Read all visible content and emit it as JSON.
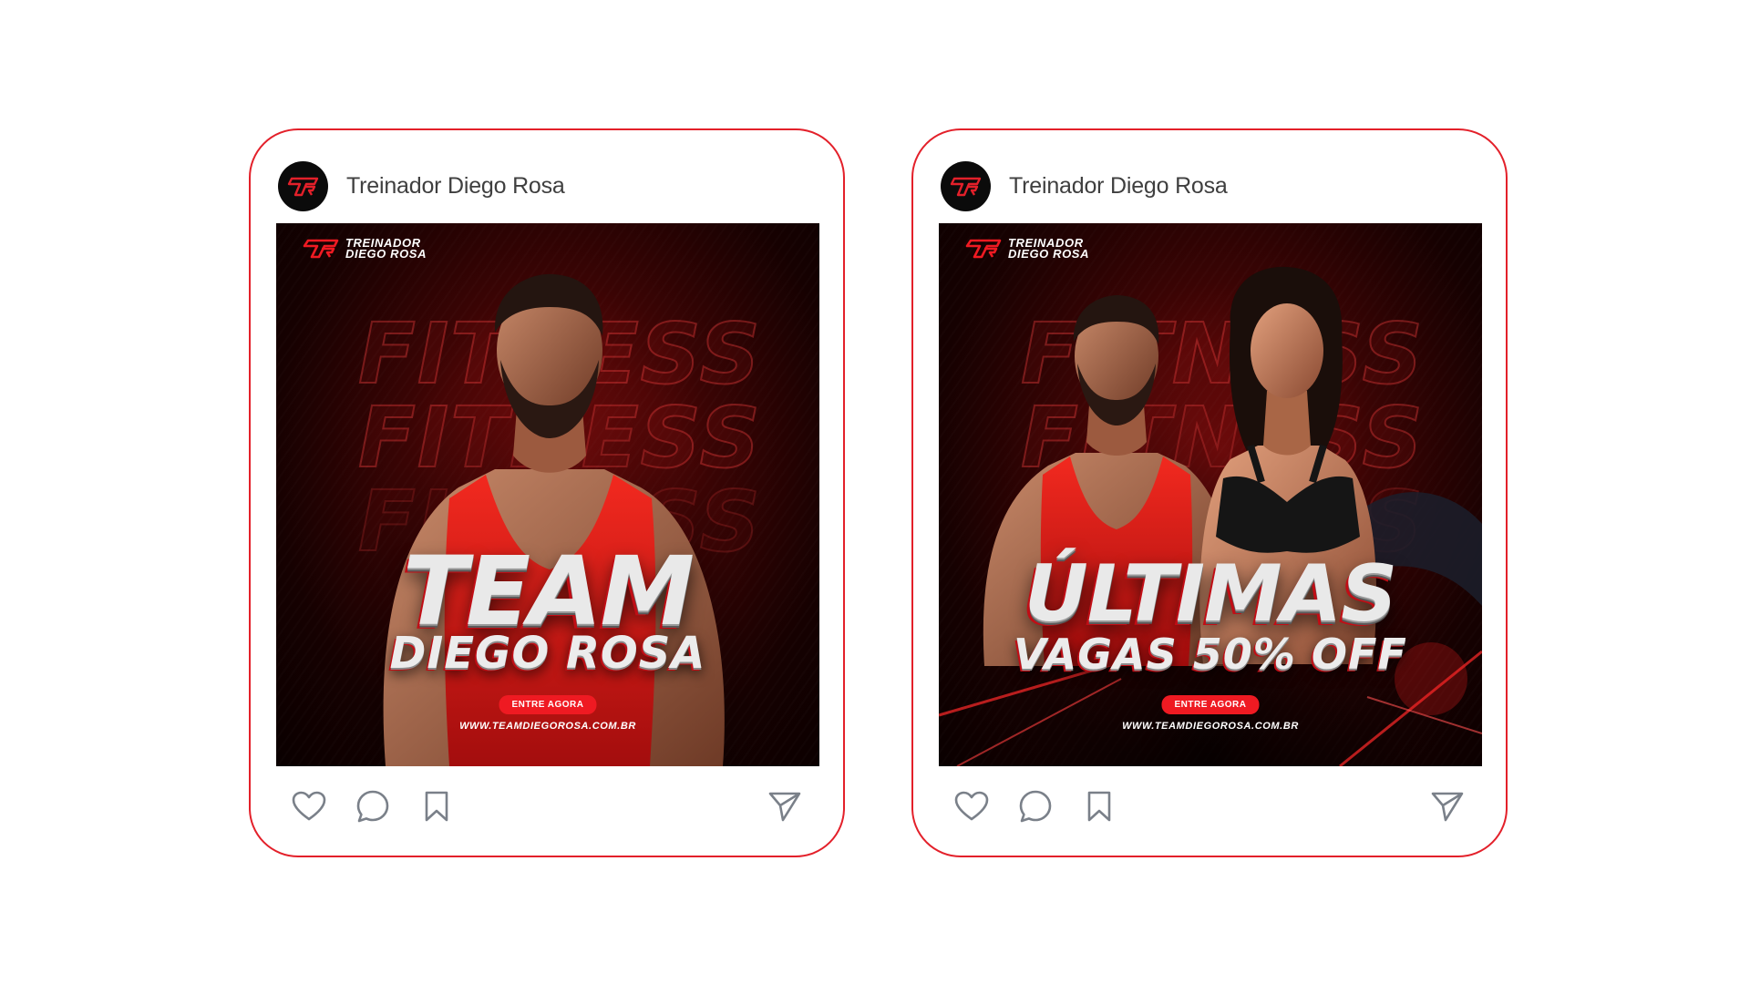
{
  "posts": [
    {
      "account_name": "Treinador Diego Rosa",
      "avatar_icon": "tr-monogram-logo",
      "creative": {
        "brand_line1": "TREINADOR",
        "brand_line2": "DIEGO ROSA",
        "background_word": "FITNESS",
        "headline_main": "TEAM",
        "headline_sub": "DIEGO ROSA",
        "cta_label": "ENTRE AGORA",
        "website": "WWW.TEAMDIEGOROSA.COM.BR"
      },
      "actions": [
        "heart-icon",
        "comment-icon",
        "bookmark-icon",
        "send-icon"
      ]
    },
    {
      "account_name": "Treinador Diego Rosa",
      "avatar_icon": "tr-monogram-logo",
      "creative": {
        "brand_line1": "TREINADOR",
        "brand_line2": "DIEGO ROSA",
        "background_word": "FITNESS",
        "headline_main": "ÚLTIMAS",
        "headline_sub": "VAGAS 50% OFF",
        "cta_label": "ENTRE AGORA",
        "website": "WWW.TEAMDIEGOROSA.COM.BR"
      },
      "actions": [
        "heart-icon",
        "comment-icon",
        "bookmark-icon",
        "send-icon"
      ]
    }
  ],
  "colors": {
    "frame_border": "#e3202a",
    "accent_red": "#ef1a22",
    "creative_bg": "#3a0404"
  }
}
